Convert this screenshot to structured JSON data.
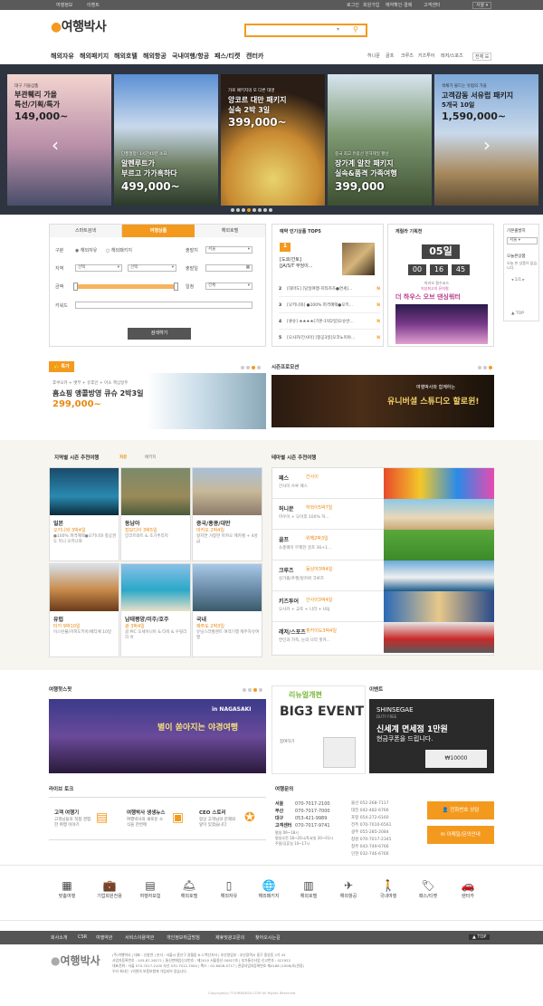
{
  "topbar": {
    "left": [
      "여행정보",
      "이벤트"
    ],
    "right": [
      "로그인",
      "회원가입",
      "예약확인·결제",
      "고객센터"
    ],
    "lang": "서울"
  },
  "logo": {
    "text": "여행박사"
  },
  "search": {
    "placeholder": "",
    "arrow": "▾",
    "icon": "search-icon"
  },
  "nav": {
    "main": [
      "해외자유",
      "해외패키지",
      "해외호텔",
      "해외항공",
      "국내여행/항공",
      "패스/티켓",
      "캔터카"
    ],
    "sub": [
      "허니문",
      "골프",
      "크루즈",
      "키즈투어",
      "레저/스포츠",
      "전체"
    ]
  },
  "hero": {
    "tiles": [
      {
        "small": "대구 기을상품",
        "title": "부관훼리 가을",
        "title2": "특선/기획/특가",
        "price": "149,000~"
      },
      {
        "small": "단풍절정! 1시간40분 소요",
        "title": "알펜루트가",
        "title2": "부르고 가가혹하다",
        "price": "499,000~"
      },
      {
        "small": "가로 패키지의 또 다른 대명",
        "title": "앙코르 대만 패키지",
        "title2": "실속 2박 3일",
        "price": "399,000~"
      },
      {
        "small": "중국 최고 유람선 천하제일 황산",
        "title": "장가계 알찬 패키지",
        "title2": "실속&품격 가족여행",
        "price": "399,000"
      },
      {
        "small": "색채가 물드는 유럽의 가을",
        "title": "고객감동 서유럽 패키지",
        "title2": "5개국 10일",
        "price": "1,590,000~"
      }
    ],
    "arrows": {
      "prev": "‹",
      "next": "›"
    }
  },
  "searchbox": {
    "tabs": [
      "스마트검색",
      "여행상품",
      "해외호텔"
    ],
    "labels": {
      "type": "구분",
      "region": "지역",
      "price": "금액",
      "keyword": "키워드",
      "depart": "출발지",
      "date": "출발일",
      "duration": "일정"
    },
    "radios": [
      "해외자유",
      "해외패키지"
    ],
    "selects": {
      "region1": "선택",
      "region2": "선택",
      "depart": "서울",
      "duration": "전체"
    },
    "button": "검색하기"
  },
  "top5": {
    "title": "예약 인기상품 TOP5",
    "first_num": "1",
    "first_title": "[도쿄/간토]",
    "first_sub": "[JA/S/T 부엉이...",
    "items": [
      {
        "num": "2",
        "text": "[대마도] [당일여행-히타카츠●면세]...",
        "badge": "N"
      },
      {
        "num": "3",
        "text": "[오키나와] ●100% 파격혜택●오키...",
        "badge": "N"
      },
      {
        "num": "4",
        "text": "[큐슈] ★★★★[기본-1박2일]오슈반...",
        "badge": "N"
      },
      {
        "num": "5",
        "text": "[오사카/간사이] [항공3일]오코노미야...",
        "badge": "N"
      }
    ]
  },
  "guerrilla": {
    "title": "게릴라 기획전",
    "dday": "05일",
    "timer": [
      "00",
      "16",
      "45"
    ],
    "promo_small": "마카오 필수코스",
    "promo_small2": "지상최고의 뮤지컬",
    "promo": "더 하우스 오브 댄싱워터"
  },
  "side": {
    "title": "기본출발지",
    "select": "서울",
    "viewed_title": "오늘본상품",
    "viewed_text": "오늘 본 상품이 없습니다.",
    "pager": "1/1",
    "top": "TOP"
  },
  "special": {
    "badge": "특가",
    "sub": "후쿠오카 + 벳부 + 유후인 + 아소 핵심일주",
    "title": "홈쇼핑 앵콜방영 큐슈 2박3일",
    "price": "299,000~"
  },
  "season_promo": {
    "title": "시즌프로모션",
    "banner1": "여행박사와 함께하는",
    "banner2": "유니버셜 스튜디오 할로윈!"
  },
  "regional": {
    "title": "지역별 시즌 추천여행",
    "tabs": [
      "자유",
      "패키지"
    ],
    "cards": [
      {
        "name": "일본",
        "price": "오키나와 3박4일",
        "desc": "●100% 파격혜택●오키나와 항공권 도 미니 오키나와"
      },
      {
        "name": "동남아",
        "price": "캄보디아 3박5일",
        "desc": "앙코르와트 & 초기추리지"
      },
      {
        "name": "중국/홍콩/대만",
        "price": "마카오 2박4일",
        "desc": "왕지연 거창한 마카오 메카텔 + 4성급"
      },
      {
        "name": "유럽",
        "price": "터키 9박10일",
        "desc": "이스탄불/카파도키아/페티예 10일"
      },
      {
        "name": "남태평양/미주/호주",
        "price": "괌 3박4일",
        "desc": "괌 PIC 오세아니아 & 타워 & 우릴리리 아"
      },
      {
        "name": "국내",
        "price": "제주도 2박3일",
        "desc": "유닝스라벌렌트 여객기행 제주자유여행"
      }
    ]
  },
  "themes": {
    "title": "테마별 시즌 추천여행",
    "items": [
      {
        "name": "패스",
        "price": "간사이",
        "desc": "간사이 쓰루 패스"
      },
      {
        "name": "허니문",
        "price": "하와이5박7일",
        "desc": "마우이 + 오아후 100% 허..."
      },
      {
        "name": "골프",
        "price": "위해2박3일",
        "desc": "소풍웨이 무제한 골프 36+1..."
      },
      {
        "name": "크루즈",
        "price": "동남아3박4일",
        "desc": "싱가폴/푸켓/랑카위 크루즈"
      },
      {
        "name": "키즈투어",
        "price": "간사이3박4일",
        "desc": "오사카 + 교토 + 나라 + USJ"
      },
      {
        "name": "레저/스포츠",
        "price": "홋카이도3박4일",
        "desc": "연인과 가족, 눈의 나라 홋카..."
      }
    ]
  },
  "spot": {
    "title": "여행핫스팟",
    "caption": "in NAGASAKI",
    "banner": "별이 쏟아지는 야경여행",
    "event_small": "리뉴얼개편",
    "event": "BIG3 EVENT",
    "event_more": "참여하기"
  },
  "event": {
    "title": "이벤트",
    "brand": "SHINSEGAE",
    "brand_sub": "DUTY FREE",
    "line1": "신세계 면세점 1만원",
    "line2": "현금쿠폰을 드립니다.",
    "coupon": "₩10000"
  },
  "livetalk": {
    "title": "라이브 토크",
    "items": [
      {
        "title": "고객 여행기",
        "desc": "고객님들의 직접 경험한 여행 이야기"
      },
      {
        "title": "여행박사 생생뉴스",
        "desc": "여행박사의 새로운 소식을 한번에"
      },
      {
        "title": "CEO 스토리",
        "desc": "항상 고객님의 문제와 앞이 있겠습니다"
      }
    ]
  },
  "contact": {
    "title": "여행문의",
    "left": [
      {
        "city": "서울",
        "phone": "070-7017-2100"
      },
      {
        "city": "부산",
        "phone": "070-7017-7000"
      },
      {
        "city": "대구",
        "phone": "053-421-9989"
      },
      {
        "city": "고객센터",
        "phone": "070-7017-9741"
      }
    ],
    "hours": [
      "평일 09~18시",
      "평일오전 18~20시/토요일 20~01시",
      "주말/공휴일 10~17시"
    ],
    "right": [
      "울산 052-268-7117",
      "대전 042-482-6766",
      "포항 054-272-6160",
      "전주 070-7010-6561",
      "광주 055-285-2084",
      "창원 070-7017-2345",
      "청주 043-749-6766",
      "인천 032-746-6766"
    ],
    "buttons": [
      "전화번호 상담",
      "이메일/문의안내"
    ]
  },
  "quicklinks": [
    "맞춤여행",
    "기업회원전용",
    "여행자보험",
    "해외호텔",
    "해외자유",
    "해외패키지",
    "해외호텔",
    "해외항공",
    "국내여행",
    "패스/티켓",
    "렌터카"
  ],
  "footer": {
    "links": [
      "회사소개",
      "CSR",
      "여행약관",
      "서비스이용약관",
      "개인정보취급방침",
      "제휴및광고문의",
      "찾아오시는길"
    ],
    "top": "▲ TOP",
    "lines": [
      "(주)여행박사 | 대표 : 신창연 | 본사 : 서울시 용산구 갈월동 8-3 벽산지사 | 부산영업부 : 부산광역시 중구 중앙동 2가 43",
      "사업자등록번호 : 105-87-26271 | 통신판매업신고번호 : 제2010 서울용산 00927호 | 부가통신사업 신고번호 : 021922",
      "대표전화 : 서울 070-7017-2100 부산 070-7012-7000 | 팩스 : 02-6008-5717 | 관광사업자등록번호 제4168 (1508)호(관광)",
      "우리 회사는 1억원의 보증보험에 가입되어 있습니다."
    ],
    "copyright": "Copyright(c) TOURBAKSA.COM All Rights Reserved."
  },
  "colors": {
    "accent": "#f39a1e",
    "dark": "#5a5a5a",
    "hero_bg": "#2e3540"
  }
}
